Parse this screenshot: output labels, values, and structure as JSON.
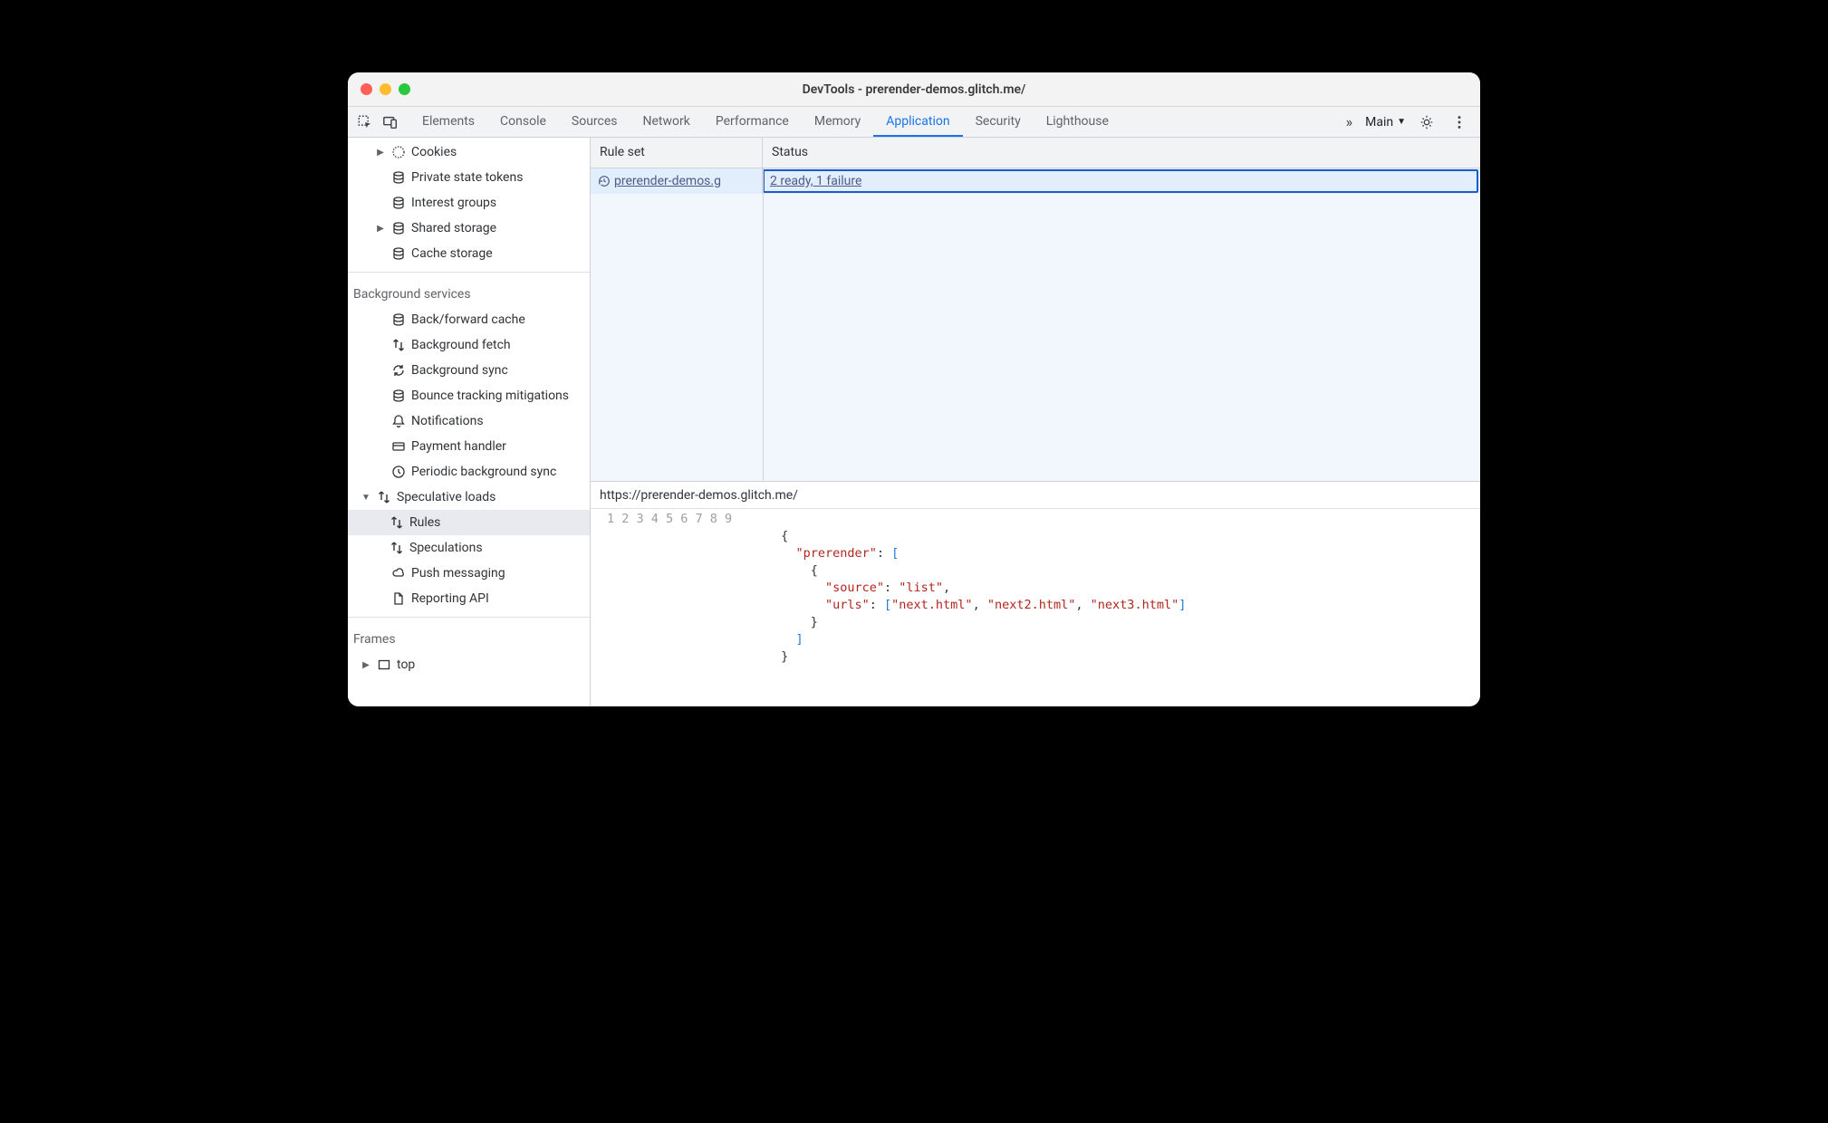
{
  "window": {
    "title": "DevTools - prerender-demos.glitch.me/"
  },
  "tabs": {
    "items": [
      "Elements",
      "Console",
      "Sources",
      "Network",
      "Performance",
      "Memory",
      "Application",
      "Security",
      "Lighthouse"
    ],
    "activeIndex": 6,
    "overflow": "»",
    "context": "Main"
  },
  "sidebar": {
    "storage": {
      "cookies": "Cookies",
      "private_state_tokens": "Private state tokens",
      "interest_groups": "Interest groups",
      "shared_storage": "Shared storage",
      "cache_storage": "Cache storage"
    },
    "background_services_label": "Background services",
    "background": {
      "bf_cache": "Back/forward cache",
      "bg_fetch": "Background fetch",
      "bg_sync": "Background sync",
      "bounce": "Bounce tracking mitigations",
      "notifications": "Notifications",
      "payment": "Payment handler",
      "periodic": "Periodic background sync",
      "speculative": "Speculative loads",
      "rules": "Rules",
      "speculations": "Speculations",
      "push": "Push messaging",
      "reporting": "Reporting API"
    },
    "frames_label": "Frames",
    "frames": {
      "top": "top"
    }
  },
  "table": {
    "headers": {
      "ruleset": "Rule set",
      "status": "Status"
    },
    "row": {
      "ruleset_label": "prerender-demos.g",
      "status_label": "2 ready, 1 failure"
    }
  },
  "detail": {
    "url": "https://prerender-demos.glitch.me/",
    "code_lines": [
      "",
      "{",
      "  \"prerender\": [",
      "    {",
      "      \"source\": \"list\",",
      "      \"urls\": [\"next.html\", \"next2.html\", \"next3.html\"]",
      "    }",
      "  ]",
      "}"
    ]
  }
}
